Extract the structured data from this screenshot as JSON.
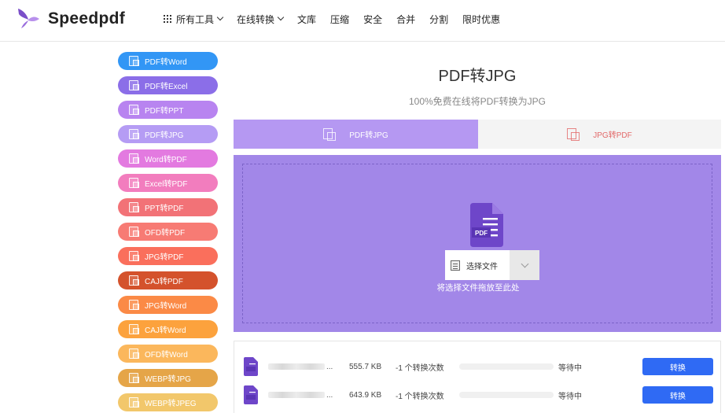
{
  "header": {
    "brand": "Speedpdf",
    "nav": [
      {
        "label": "所有工具",
        "has_grid": true,
        "has_chevron": true
      },
      {
        "label": "在线转换",
        "has_grid": false,
        "has_chevron": true
      },
      {
        "label": "文库",
        "has_grid": false,
        "has_chevron": false
      },
      {
        "label": "压缩",
        "has_grid": false,
        "has_chevron": false
      },
      {
        "label": "安全",
        "has_grid": false,
        "has_chevron": false
      },
      {
        "label": "合并",
        "has_grid": false,
        "has_chevron": false
      },
      {
        "label": "分割",
        "has_grid": false,
        "has_chevron": false
      },
      {
        "label": "限时优惠",
        "has_grid": false,
        "has_chevron": false
      }
    ]
  },
  "sidebar": {
    "items": [
      {
        "label": "PDF转Word",
        "color": "#3296f5"
      },
      {
        "label": "PDF转Excel",
        "color": "#8b6ee8"
      },
      {
        "label": "PDF转PPT",
        "color": "#b884f0"
      },
      {
        "label": "PDF转JPG",
        "color": "#b59cf4"
      },
      {
        "label": "Word转PDF",
        "color": "#e37ae0"
      },
      {
        "label": "Excel转PDF",
        "color": "#f27dbe"
      },
      {
        "label": "PPT转PDF",
        "color": "#f27277"
      },
      {
        "label": "OFD转PDF",
        "color": "#f77b74"
      },
      {
        "label": "JPG转PDF",
        "color": "#fa6f5c"
      },
      {
        "label": "CAJ转PDF",
        "color": "#d4522c"
      },
      {
        "label": "JPG转Word",
        "color": "#fb8a46"
      },
      {
        "label": "CAJ转Word",
        "color": "#fca23d"
      },
      {
        "label": "OFD转Word",
        "color": "#fbb75c"
      },
      {
        "label": "WEBP转JPG",
        "color": "#e5a548"
      },
      {
        "label": "WEBP转JPEG",
        "color": "#f2c76b"
      }
    ]
  },
  "main": {
    "title": "PDF转JPG",
    "subtitle": "100%免费在线将PDF转换为JPG",
    "tabs": [
      {
        "label": "PDF转JPG",
        "active": true
      },
      {
        "label": "JPG转PDF",
        "active": false
      }
    ],
    "upload": {
      "pdf_icon_label": "PDF",
      "choose_label": "选择文件",
      "drag_hint": "将选择文件拖放至此处"
    },
    "files": [
      {
        "name_suffix": "...",
        "size": "555.7 KB",
        "count": "-1 个转换次数",
        "progress": 0,
        "status": "等待中",
        "button": "转换"
      },
      {
        "name_suffix": "...",
        "size": "643.9 KB",
        "count": "-1 个转换次数",
        "progress": 0,
        "status": "等待中",
        "button": "转换"
      }
    ]
  },
  "colors": {
    "tab_active": "#b598f2",
    "drop_zone": "#a287e8",
    "pdf_icon": "#6e46c9",
    "convert_button": "#2f6af4"
  }
}
